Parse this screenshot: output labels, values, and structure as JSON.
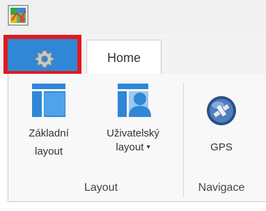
{
  "app": {
    "icon": "map-app-icon"
  },
  "tabs": {
    "file": {
      "icon": "gear-icon",
      "highlight_color": "#e3191d"
    },
    "home": "Home"
  },
  "ribbon": {
    "groups": {
      "layout": {
        "label": "Layout",
        "buttons": {
          "basic": {
            "line1": "Základní",
            "line2": "layout",
            "icon": "basic-layout-icon"
          },
          "user": {
            "line1": "Uživatelský",
            "line2": "layout",
            "caret": "▾",
            "icon": "user-layout-icon"
          }
        }
      },
      "navigation": {
        "label": "Navigace",
        "buttons": {
          "gps": {
            "label": "GPS",
            "icon": "gps-icon"
          }
        }
      }
    }
  },
  "colors": {
    "accent": "#2f87d6",
    "ribbon_border": "#c8c8c8"
  }
}
